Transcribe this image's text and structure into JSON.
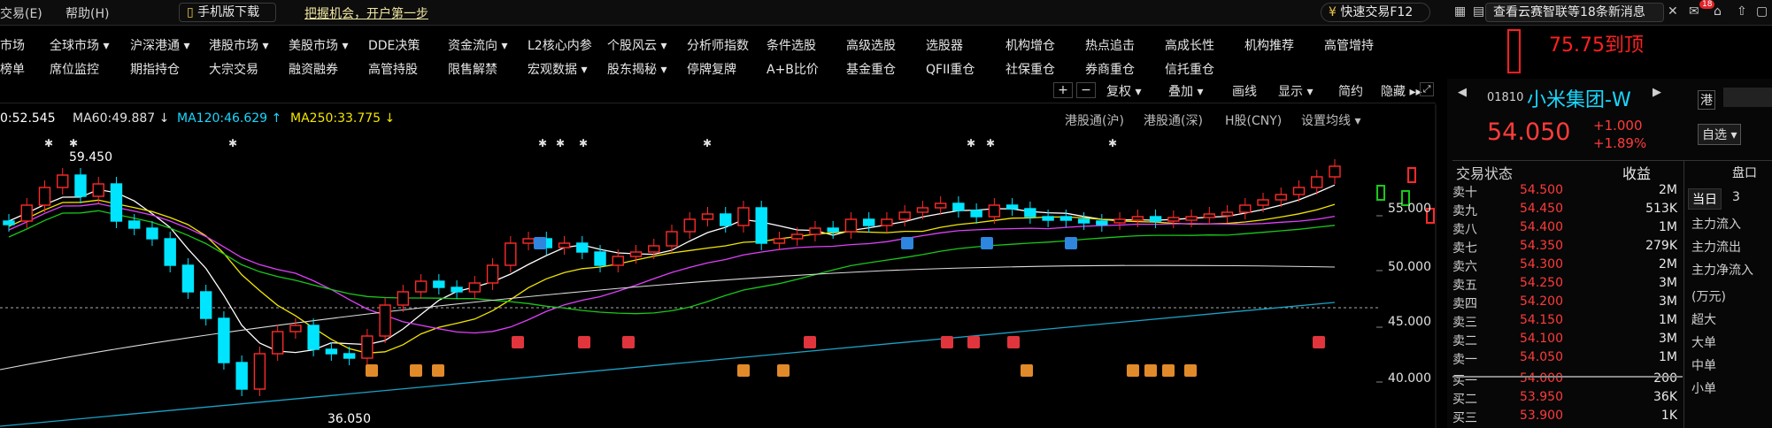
{
  "top_menu": {
    "trade": "交易(E)",
    "help": "帮助(H)",
    "mobile": "手机版下载",
    "promo": "把握机会，开户第一步",
    "quick": "快速交易F12",
    "news": "查看云赛智联等18条新消息",
    "badge": "18"
  },
  "menu_row1": [
    "市场",
    "全球市场 ▾",
    "沪深港通 ▾",
    "港股市场 ▾",
    "美股市场 ▾",
    "DDE决策",
    "资金流向 ▾",
    "L2核心内参",
    "个股风云 ▾",
    "分析师指数",
    "条件选股",
    "高级选股",
    "选股器",
    "机构增仓",
    "热点追击",
    "高成长性",
    "机构推荐",
    "高管增持"
  ],
  "menu_row2": [
    "榜单",
    "席位监控",
    "期指持仓",
    "大宗交易",
    "融资融券",
    "高管持股",
    "限售解禁",
    "宏观数据 ▾",
    "股东揭秘 ▾",
    "停牌复牌",
    "A+B比价",
    "基金重仓",
    "QFII重仓",
    "社保重仓",
    "券商重仓",
    "信托重仓"
  ],
  "annotation": "75.75到顶",
  "toolbar": {
    "plus": "+",
    "minus": "−",
    "fuquan": "复权 ▾",
    "diejia": "叠加 ▾",
    "huaxian": "画线",
    "xianshi": "显示 ▾",
    "jianyue": "简约",
    "yincang": "隐藏 ▸▸"
  },
  "ma": {
    "ma_first": "0:52.545",
    "ma60": "MA60:49.887 ↓",
    "ma120": "MA120:46.629 ↑",
    "ma250": "MA250:33.775 ↓"
  },
  "chart_ctrl": [
    "港股通(沪)",
    "港股通(深)",
    "H股(CNY)",
    "设置均线 ▾"
  ],
  "price_axis": [
    "55.000",
    "50.000",
    "45.000",
    "40.000"
  ],
  "price_marks": {
    "high": "59.450",
    "low": "36.050"
  },
  "stock": {
    "code": "01810",
    "name": "小米集团-W",
    "market": "港",
    "price": "54.050",
    "change": "+1.000",
    "pct": "+1.89%",
    "self_select": "自选 ▾"
  },
  "panel": {
    "status": "交易状态",
    "income": "收益",
    "disc": "盘口",
    "today": "当日",
    "three": "3"
  },
  "order_book": [
    {
      "label": "卖十",
      "price": "54.500",
      "vol": "2M"
    },
    {
      "label": "卖九",
      "price": "54.450",
      "vol": "513K"
    },
    {
      "label": "卖八",
      "price": "54.400",
      "vol": "1M"
    },
    {
      "label": "卖七",
      "price": "54.350",
      "vol": "279K"
    },
    {
      "label": "卖六",
      "price": "54.300",
      "vol": "2M"
    },
    {
      "label": "卖五",
      "price": "54.250",
      "vol": "3M"
    },
    {
      "label": "卖四",
      "price": "54.200",
      "vol": "3M"
    },
    {
      "label": "卖三",
      "price": "54.150",
      "vol": "1M"
    },
    {
      "label": "卖二",
      "price": "54.100",
      "vol": "3M"
    },
    {
      "label": "卖一",
      "price": "54.050",
      "vol": "1M"
    },
    {
      "label": "买一",
      "price": "54.000",
      "vol": "200"
    },
    {
      "label": "买二",
      "price": "53.950",
      "vol": "36K"
    },
    {
      "label": "买三",
      "price": "53.900",
      "vol": "1K"
    }
  ],
  "fund_flow": [
    "主力流入",
    "主力流出",
    "主力净流入",
    "(万元)",
    "超大",
    "大单",
    "中单",
    "小单"
  ],
  "colors": {
    "up": "#ff2a2a",
    "down": "#00e5ff",
    "bg": "#000000",
    "ma_white": "#ffffff",
    "ma_yellow": "#f2e600",
    "ma_magenta": "#e040fb",
    "ma_green": "#19c819",
    "ma_cyan": "#1aa3c8"
  }
}
